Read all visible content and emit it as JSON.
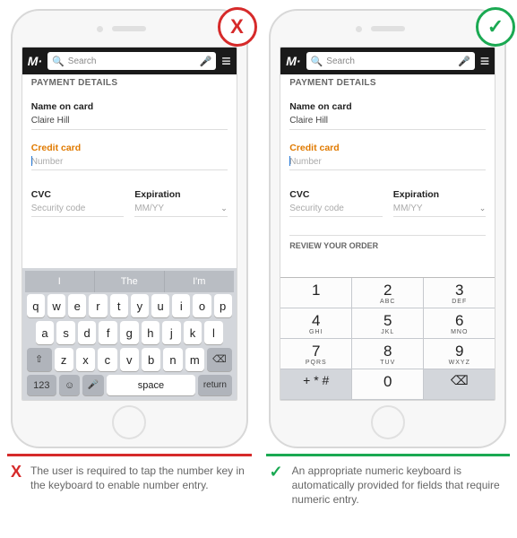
{
  "badges": {
    "bad": "X",
    "good": "✓"
  },
  "topbar": {
    "logo": "M·",
    "search_placeholder": "Search"
  },
  "form": {
    "section": "PAYMENT DETAILS",
    "name_label": "Name on card",
    "name_value": "Claire Hill",
    "cc_label": "Credit card",
    "cc_placeholder": "Number",
    "cvc_label": "CVC",
    "cvc_placeholder": "Security code",
    "exp_label": "Expiration",
    "exp_placeholder": "MM/YY",
    "review": "REVIEW YOUR ORDER"
  },
  "qwerty": {
    "suggestions": [
      "I",
      "The",
      "I'm"
    ],
    "row1": [
      "q",
      "w",
      "e",
      "r",
      "t",
      "y",
      "u",
      "i",
      "o",
      "p"
    ],
    "row2": [
      "a",
      "s",
      "d",
      "f",
      "g",
      "h",
      "j",
      "k",
      "l"
    ],
    "row3": [
      "z",
      "x",
      "c",
      "v",
      "b",
      "n",
      "m"
    ],
    "shift": "⇧",
    "backspace": "⌫",
    "numkey": "123",
    "emoji": "☺",
    "mic": "🎤",
    "space": "space",
    "return": "return"
  },
  "numpad": {
    "keys": [
      [
        {
          "n": "1",
          "s": ""
        },
        {
          "n": "2",
          "s": "ABC"
        },
        {
          "n": "3",
          "s": "DEF"
        }
      ],
      [
        {
          "n": "4",
          "s": "GHI"
        },
        {
          "n": "5",
          "s": "JKL"
        },
        {
          "n": "6",
          "s": "MNO"
        }
      ],
      [
        {
          "n": "7",
          "s": "PQRS"
        },
        {
          "n": "8",
          "s": "TUV"
        },
        {
          "n": "9",
          "s": "WXYZ"
        }
      ]
    ],
    "bottom": {
      "sym": "+ * #",
      "zero": "0",
      "bksp": "⌫"
    }
  },
  "captions": {
    "bad": "The user is required to tap the number key in the keyboard to enable number entry.",
    "good": "An appropriate numeric keyboard is automatically provided for fields that require numeric entry."
  }
}
